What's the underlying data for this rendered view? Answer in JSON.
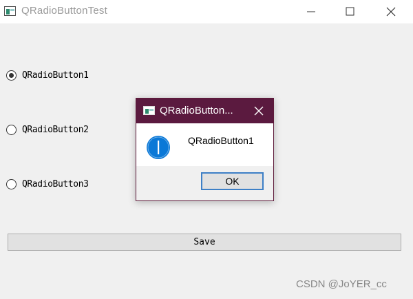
{
  "window": {
    "title": "QRadioButtonTest",
    "icon": "app-window-icon",
    "controls": [
      "minimize-icon",
      "maximize-icon",
      "close-icon"
    ]
  },
  "radios": [
    {
      "label": "QRadioButton1",
      "checked": true
    },
    {
      "label": "QRadioButton2",
      "checked": false
    },
    {
      "label": "QRadioButton3",
      "checked": false
    }
  ],
  "save_button": {
    "label": "Save"
  },
  "dialog": {
    "title": "QRadioButton...",
    "message": "QRadioButton1",
    "icon": "information-icon",
    "ok_label": "OK",
    "titlebar_color": "#5b1a3f",
    "icon_color": "#0a78d7"
  },
  "watermark": "CSDN @JoYER_cc"
}
